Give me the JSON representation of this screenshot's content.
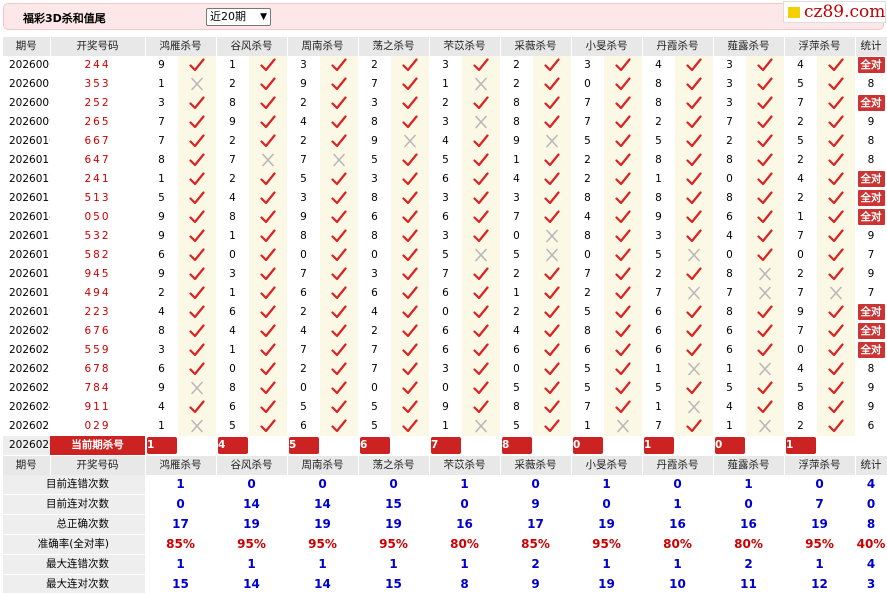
{
  "header": {
    "title": "福彩3D杀和值尾",
    "period_select": "近20期",
    "logo": "cz89.com"
  },
  "columns": [
    "期号",
    "开奖号码",
    "鸿雁杀号",
    "谷风杀号",
    "周南杀号",
    "荡之杀号",
    "芣苡杀号",
    "采薇杀号",
    "小旻杀号",
    "丹霞杀号",
    "薤露杀号",
    "浮萍杀号",
    "统计"
  ],
  "rows": [
    {
      "period": "2026006",
      "draw": "244",
      "kills": [
        9,
        1,
        3,
        2,
        3,
        2,
        3,
        4,
        3,
        4
      ],
      "hits": [
        1,
        1,
        1,
        1,
        1,
        1,
        1,
        1,
        1,
        1
      ],
      "stat": "全对"
    },
    {
      "period": "2026007",
      "draw": "353",
      "kills": [
        1,
        2,
        9,
        7,
        1,
        2,
        0,
        8,
        3,
        5
      ],
      "hits": [
        0,
        1,
        1,
        1,
        0,
        1,
        1,
        1,
        1,
        1
      ],
      "stat": "8"
    },
    {
      "period": "2026008",
      "draw": "252",
      "kills": [
        3,
        8,
        2,
        3,
        2,
        8,
        7,
        8,
        3,
        7
      ],
      "hits": [
        1,
        1,
        1,
        1,
        1,
        1,
        1,
        1,
        1,
        1
      ],
      "stat": "全对"
    },
    {
      "period": "2026009",
      "draw": "265",
      "kills": [
        7,
        9,
        4,
        8,
        3,
        8,
        7,
        2,
        7,
        2
      ],
      "hits": [
        1,
        1,
        1,
        1,
        0,
        1,
        1,
        1,
        1,
        1
      ],
      "stat": "9"
    },
    {
      "period": "2026010",
      "draw": "667",
      "kills": [
        7,
        2,
        2,
        9,
        4,
        9,
        5,
        5,
        2,
        5
      ],
      "hits": [
        1,
        1,
        1,
        0,
        1,
        0,
        1,
        1,
        1,
        1
      ],
      "stat": "8"
    },
    {
      "period": "2026011",
      "draw": "647",
      "kills": [
        8,
        7,
        7,
        5,
        5,
        1,
        2,
        8,
        8,
        2
      ],
      "hits": [
        1,
        0,
        0,
        1,
        1,
        1,
        1,
        1,
        1,
        1
      ],
      "stat": "8"
    },
    {
      "period": "2026012",
      "draw": "241",
      "kills": [
        1,
        2,
        5,
        3,
        6,
        4,
        2,
        1,
        0,
        4
      ],
      "hits": [
        1,
        1,
        1,
        1,
        1,
        1,
        1,
        1,
        1,
        1
      ],
      "stat": "全对"
    },
    {
      "period": "2026013",
      "draw": "513",
      "kills": [
        5,
        4,
        3,
        8,
        3,
        3,
        8,
        8,
        8,
        2
      ],
      "hits": [
        1,
        1,
        1,
        1,
        1,
        1,
        1,
        1,
        1,
        1
      ],
      "stat": "全对"
    },
    {
      "period": "2026014",
      "draw": "050",
      "kills": [
        9,
        8,
        9,
        6,
        6,
        7,
        4,
        9,
        6,
        1
      ],
      "hits": [
        1,
        1,
        1,
        1,
        1,
        1,
        1,
        1,
        1,
        1
      ],
      "stat": "全对"
    },
    {
      "period": "2026015",
      "draw": "532",
      "kills": [
        9,
        1,
        8,
        8,
        3,
        0,
        8,
        3,
        4,
        7
      ],
      "hits": [
        1,
        1,
        1,
        1,
        1,
        0,
        1,
        1,
        1,
        1
      ],
      "stat": "9"
    },
    {
      "period": "2026016",
      "draw": "582",
      "kills": [
        6,
        0,
        0,
        0,
        5,
        5,
        0,
        5,
        0,
        0
      ],
      "hits": [
        1,
        1,
        1,
        1,
        0,
        0,
        1,
        0,
        1,
        1
      ],
      "stat": "7"
    },
    {
      "period": "2026017",
      "draw": "945",
      "kills": [
        9,
        3,
        7,
        3,
        7,
        2,
        7,
        2,
        8,
        2
      ],
      "hits": [
        1,
        1,
        1,
        1,
        1,
        1,
        1,
        1,
        0,
        1
      ],
      "stat": "9"
    },
    {
      "period": "2026018",
      "draw": "494",
      "kills": [
        2,
        1,
        6,
        6,
        6,
        1,
        2,
        7,
        7,
        7
      ],
      "hits": [
        1,
        1,
        1,
        1,
        1,
        1,
        1,
        0,
        0,
        0
      ],
      "stat": "7"
    },
    {
      "period": "2026019",
      "draw": "223",
      "kills": [
        4,
        6,
        2,
        4,
        0,
        2,
        5,
        6,
        8,
        9
      ],
      "hits": [
        1,
        1,
        1,
        1,
        1,
        1,
        1,
        1,
        1,
        1
      ],
      "stat": "全对"
    },
    {
      "period": "2026020",
      "draw": "676",
      "kills": [
        8,
        4,
        4,
        2,
        6,
        4,
        8,
        6,
        6,
        7
      ],
      "hits": [
        1,
        1,
        1,
        1,
        1,
        1,
        1,
        1,
        1,
        1
      ],
      "stat": "全对"
    },
    {
      "period": "2026021",
      "draw": "559",
      "kills": [
        3,
        1,
        7,
        7,
        6,
        6,
        6,
        6,
        6,
        0
      ],
      "hits": [
        1,
        1,
        1,
        1,
        1,
        1,
        1,
        1,
        1,
        1
      ],
      "stat": "全对"
    },
    {
      "period": "2026022",
      "draw": "678",
      "kills": [
        6,
        0,
        2,
        7,
        3,
        0,
        5,
        1,
        1,
        4
      ],
      "hits": [
        1,
        1,
        1,
        1,
        1,
        1,
        1,
        0,
        0,
        1
      ],
      "stat": "8"
    },
    {
      "period": "2026023",
      "draw": "784",
      "kills": [
        9,
        8,
        0,
        0,
        0,
        5,
        5,
        5,
        5,
        5
      ],
      "hits": [
        0,
        1,
        1,
        1,
        1,
        1,
        1,
        1,
        1,
        1
      ],
      "stat": "9"
    },
    {
      "period": "2026024",
      "draw": "911",
      "kills": [
        4,
        6,
        5,
        5,
        9,
        8,
        7,
        1,
        4,
        8
      ],
      "hits": [
        1,
        1,
        1,
        1,
        1,
        1,
        1,
        0,
        1,
        1
      ],
      "stat": "9"
    },
    {
      "period": "2026025",
      "draw": "029",
      "kills": [
        1,
        5,
        6,
        5,
        1,
        5,
        1,
        7,
        1,
        2
      ],
      "hits": [
        0,
        1,
        1,
        1,
        0,
        1,
        0,
        1,
        0,
        1
      ],
      "stat": "6"
    }
  ],
  "current": {
    "period": "2026026",
    "label": "当前期杀号",
    "kills": [
      1,
      4,
      5,
      6,
      7,
      8,
      0,
      1,
      0,
      1
    ]
  },
  "stats_header": [
    "期号",
    "开奖号码",
    "鸿雁杀号",
    "谷风杀号",
    "周南杀号",
    "荡之杀号",
    "芣苡杀号",
    "采薇杀号",
    "小旻杀号",
    "丹霞杀号",
    "薤露杀号",
    "浮萍杀号",
    "统计"
  ],
  "stats": [
    {
      "label": "目前连错次数",
      "values": [
        "1",
        "0",
        "0",
        "0",
        "1",
        "0",
        "1",
        "0",
        "1",
        "0",
        "4"
      ],
      "kind": "num"
    },
    {
      "label": "目前连对次数",
      "values": [
        "0",
        "14",
        "14",
        "15",
        "0",
        "9",
        "0",
        "1",
        "0",
        "7",
        "0"
      ],
      "kind": "num"
    },
    {
      "label": "总正确次数",
      "values": [
        "17",
        "19",
        "19",
        "19",
        "16",
        "17",
        "19",
        "16",
        "16",
        "19",
        "8"
      ],
      "kind": "num"
    },
    {
      "label": "准确率(全对率)",
      "values": [
        "85%",
        "95%",
        "95%",
        "95%",
        "80%",
        "85%",
        "95%",
        "80%",
        "80%",
        "95%",
        "40%"
      ],
      "kind": "pct"
    },
    {
      "label": "最大连错次数",
      "values": [
        "1",
        "1",
        "1",
        "1",
        "1",
        "2",
        "1",
        "1",
        "2",
        "1",
        "4"
      ],
      "kind": "num"
    },
    {
      "label": "最大连对次数",
      "values": [
        "15",
        "14",
        "14",
        "15",
        "8",
        "9",
        "19",
        "10",
        "11",
        "12",
        "3"
      ],
      "kind": "num"
    }
  ]
}
